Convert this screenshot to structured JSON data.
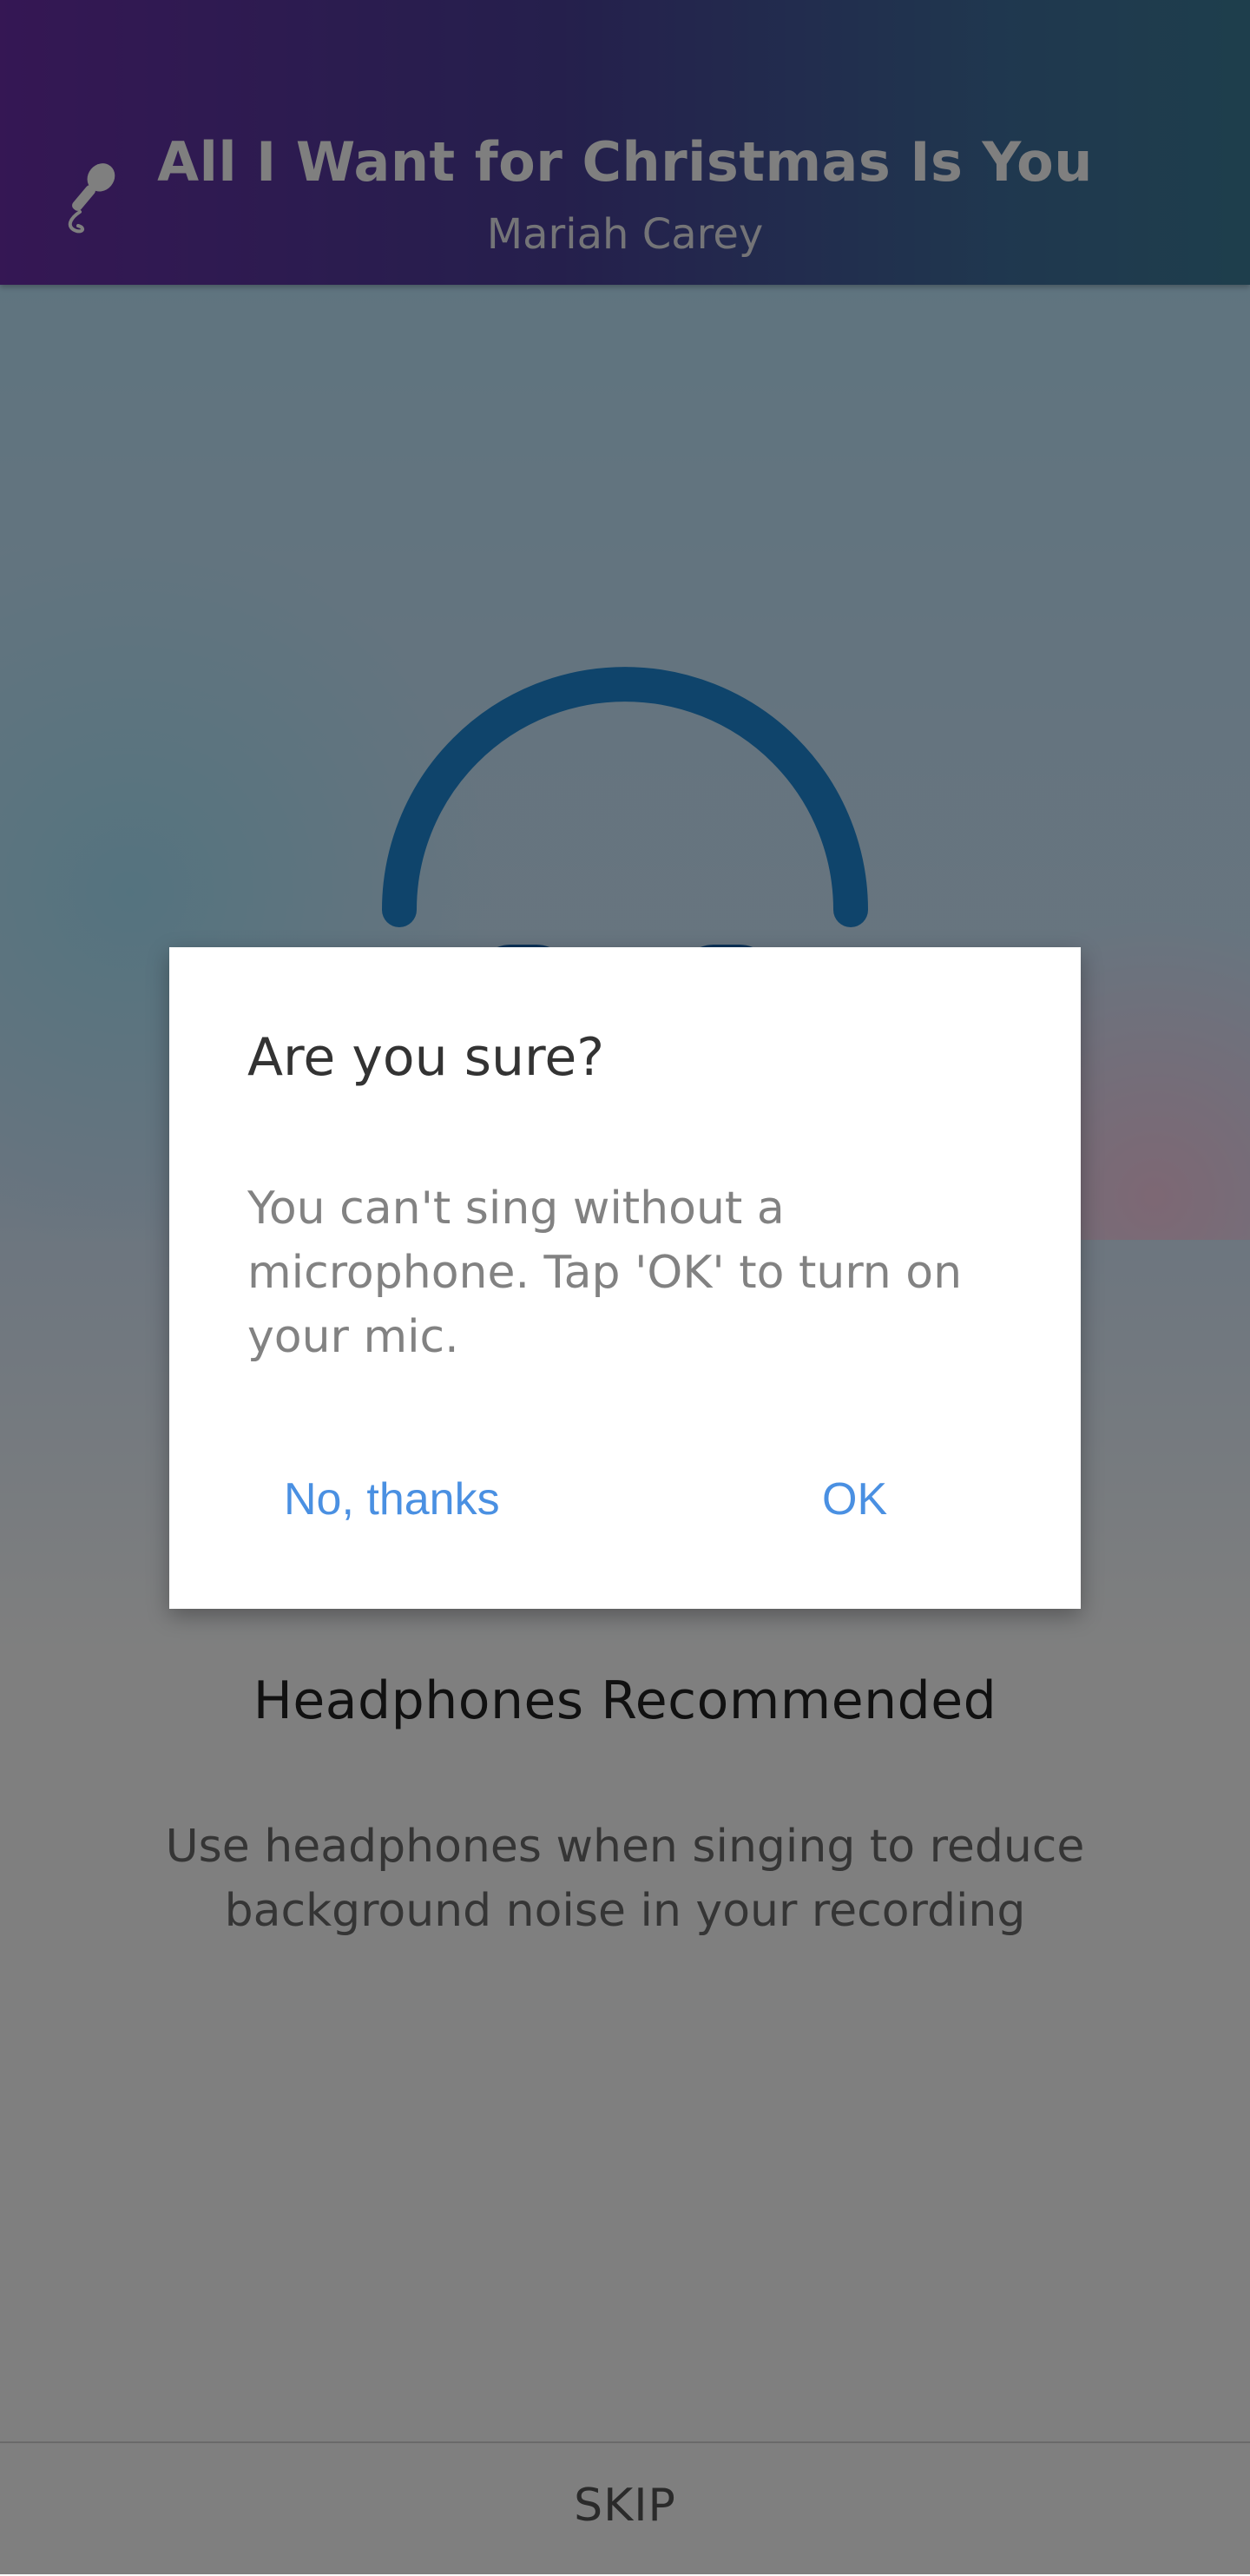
{
  "header": {
    "song_title": "All I Want for Christmas Is You",
    "artist": "Mariah Carey",
    "icon": "microphone-icon"
  },
  "content": {
    "illustration": "headphones-icon",
    "recommendation_title": "Headphones Recommended",
    "recommendation_text": "Use headphones when singing to reduce background noise in your recording",
    "skip_label": "SKIP"
  },
  "dialog": {
    "title": "Are you sure?",
    "message": "You can't sing without a microphone. Tap 'OK' to turn on your mic.",
    "negative_label": "No,  thanks",
    "positive_label": "OK"
  },
  "colors": {
    "header_start": "#6a2ea8",
    "header_end": "#3d7d99",
    "accent_blue": "#1e88d6",
    "button_text": "#4a90e2"
  }
}
